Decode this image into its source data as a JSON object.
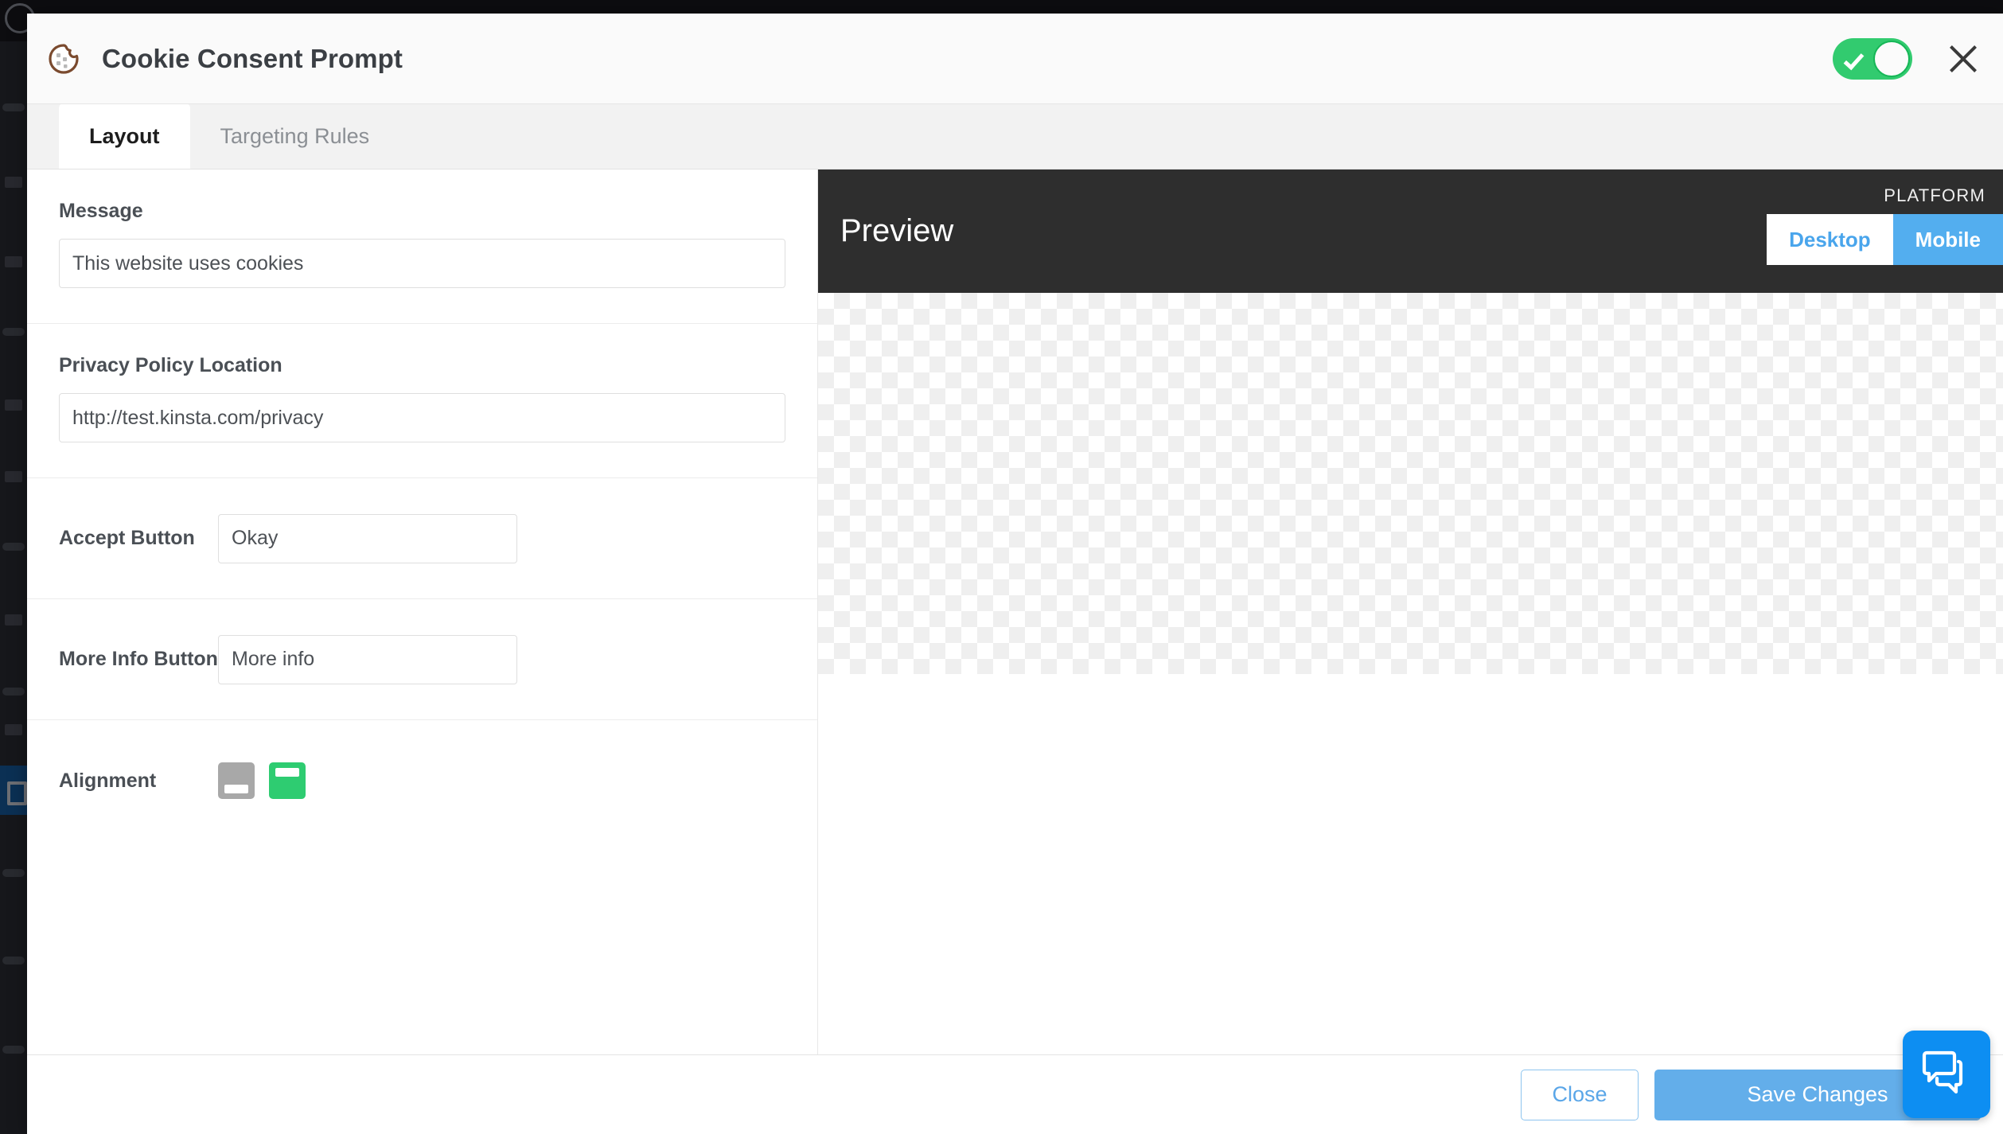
{
  "background": {
    "admin_bar_present": true,
    "sidebar_present": true
  },
  "modal": {
    "icon": "cookie-icon",
    "title": "Cookie Consent Prompt",
    "enabled_toggle": {
      "state": "on",
      "icon": "check-icon",
      "color": "#32cb6f"
    },
    "close_icon": "close-icon",
    "tabs": [
      {
        "label": "Layout",
        "active": true
      },
      {
        "label": "Targeting Rules",
        "active": false
      }
    ],
    "settings": {
      "message": {
        "label": "Message",
        "value": "This website uses cookies",
        "placeholder": "This website uses cookies"
      },
      "privacy_policy": {
        "label": "Privacy Policy Location",
        "value": "http://test.kinsta.com/privacy",
        "placeholder": "http://test.kinsta.com/privacy"
      },
      "accept_button": {
        "label": "Accept Button",
        "value": "Okay",
        "placeholder": "Okay"
      },
      "more_info_button": {
        "label": "More Info Button",
        "value": "More info",
        "placeholder": "More info"
      },
      "alignment": {
        "label": "Alignment",
        "options": [
          {
            "name": "bottom",
            "icon": "align-bottom-icon",
            "selected": false,
            "color": "#a8a8a8"
          },
          {
            "name": "top",
            "icon": "align-top-icon",
            "selected": true,
            "color": "#2ecc71"
          }
        ]
      }
    },
    "preview": {
      "title": "Preview",
      "platform_label": "PLATFORM",
      "platforms": [
        {
          "label": "Desktop",
          "active": false
        },
        {
          "label": "Mobile",
          "active": true
        }
      ],
      "canvas": "transparent-checkerboard"
    },
    "footer": {
      "close_label": "Close",
      "save_label": "Save Changes"
    }
  },
  "chat_widget": {
    "icon": "chat-bubbles-icon",
    "color": "#0d8ef2"
  }
}
